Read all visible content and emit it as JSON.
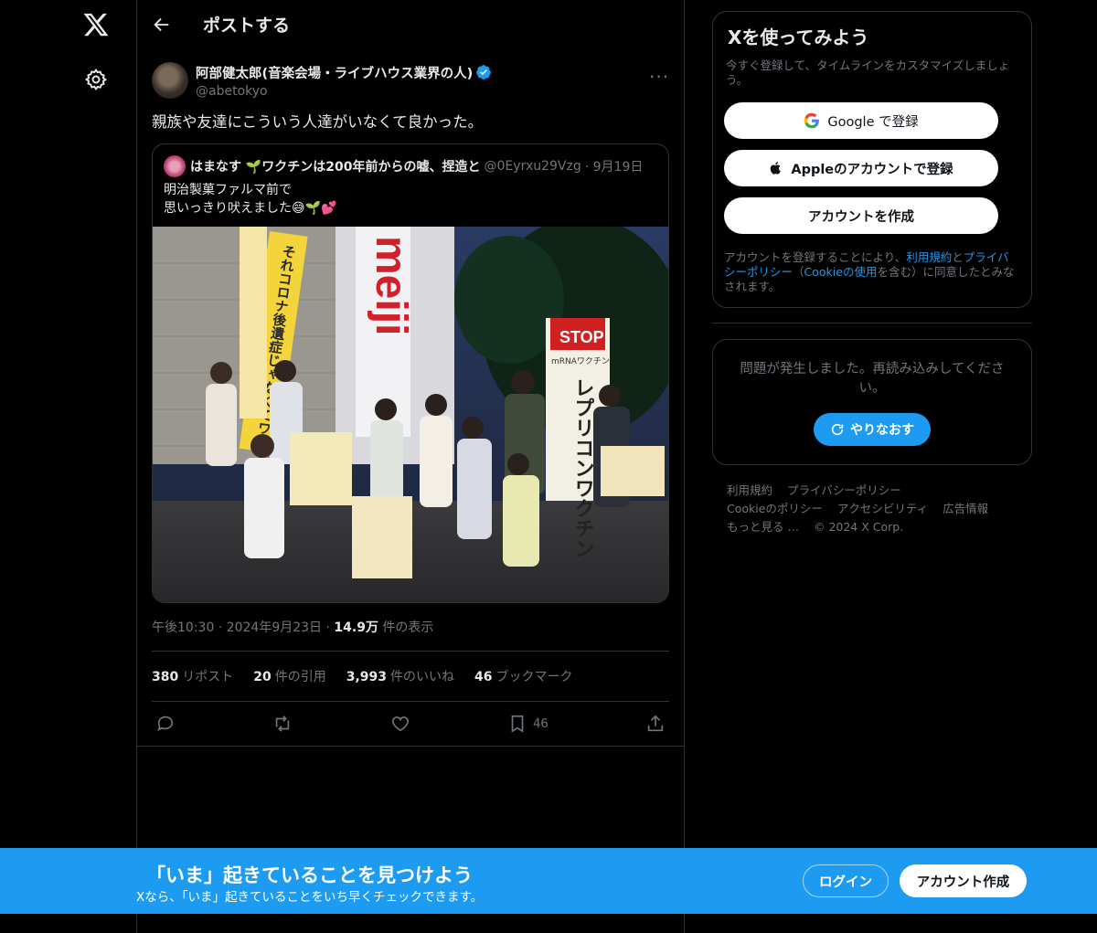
{
  "header": {
    "title": "ポストする"
  },
  "post": {
    "author_name": "阿部健太郎(音楽会場・ライブハウス業界の人)",
    "author_handle": "@abetokyo",
    "text": "親族や友達にこういう人達がいなくて良かった。",
    "quote": {
      "name": "はまなす 🌱ワクチンは200年前からの嘘、捏造と",
      "handle": "@0Eyrxu29Vzg",
      "date": "· 9月19日",
      "text_line1": "明治製菓ファルマ前で",
      "text_line2": "思いっきり吠えました😅🌱💕",
      "photo_texts": {
        "brand": "meiji",
        "banner_left": "それコロナ後遺症じゃなくてワクチン後遺症",
        "stop": "STOP",
        "stop_sub": "mRNAワクチン",
        "banner_right": "レプリコンワクチン"
      }
    },
    "time": "午後10:30 · 2024年9月23日 · ",
    "views": "14.9万",
    "views_suffix": " 件の表示",
    "stats": {
      "reposts_count": "380",
      "reposts_label": "リポスト",
      "quotes_count": "20",
      "quotes_label": "件の引用",
      "likes_count": "3,993",
      "likes_label": "件のいいね",
      "bookmarks_count": "46",
      "bookmarks_label": "ブックマーク"
    },
    "actions": {
      "bookmark_count": "46"
    }
  },
  "signup_card": {
    "title": "Xを使ってみよう",
    "subtitle": "今すぐ登録して、タイムラインをカスタマイズしましょう。",
    "google_label": "Google で登録",
    "apple_label": "Appleのアカウントで登録",
    "create_label": "アカウントを作成",
    "terms_1": "アカウントを登録することにより、",
    "terms_link1": "利用規約",
    "terms_2": "と",
    "terms_link2": "プライバシーポリシー",
    "terms_3": "（",
    "terms_link3": "Cookieの使用",
    "terms_4": "を含む）に同意したとみなされます。"
  },
  "error_card": {
    "text": "問題が発生しました。再読み込みしてください。",
    "retry_label": "やりなおす"
  },
  "footer": {
    "links": [
      "利用規約",
      "プライバシーポリシー",
      "Cookieのポリシー",
      "アクセシビリティ",
      "広告情報",
      "もっと見る …",
      "© 2024 X Corp."
    ]
  },
  "bottom_bar": {
    "title": "「いま」起きていることを見つけよう",
    "subtitle": "Xなら、「いま」起きていることをいち早くチェックできます。",
    "login_label": "ログイン",
    "signup_label": "アカウント作成"
  },
  "colors": {
    "accent": "#1d9bf0",
    "background": "#000000",
    "border": "#2f3336",
    "muted": "#71767b"
  }
}
